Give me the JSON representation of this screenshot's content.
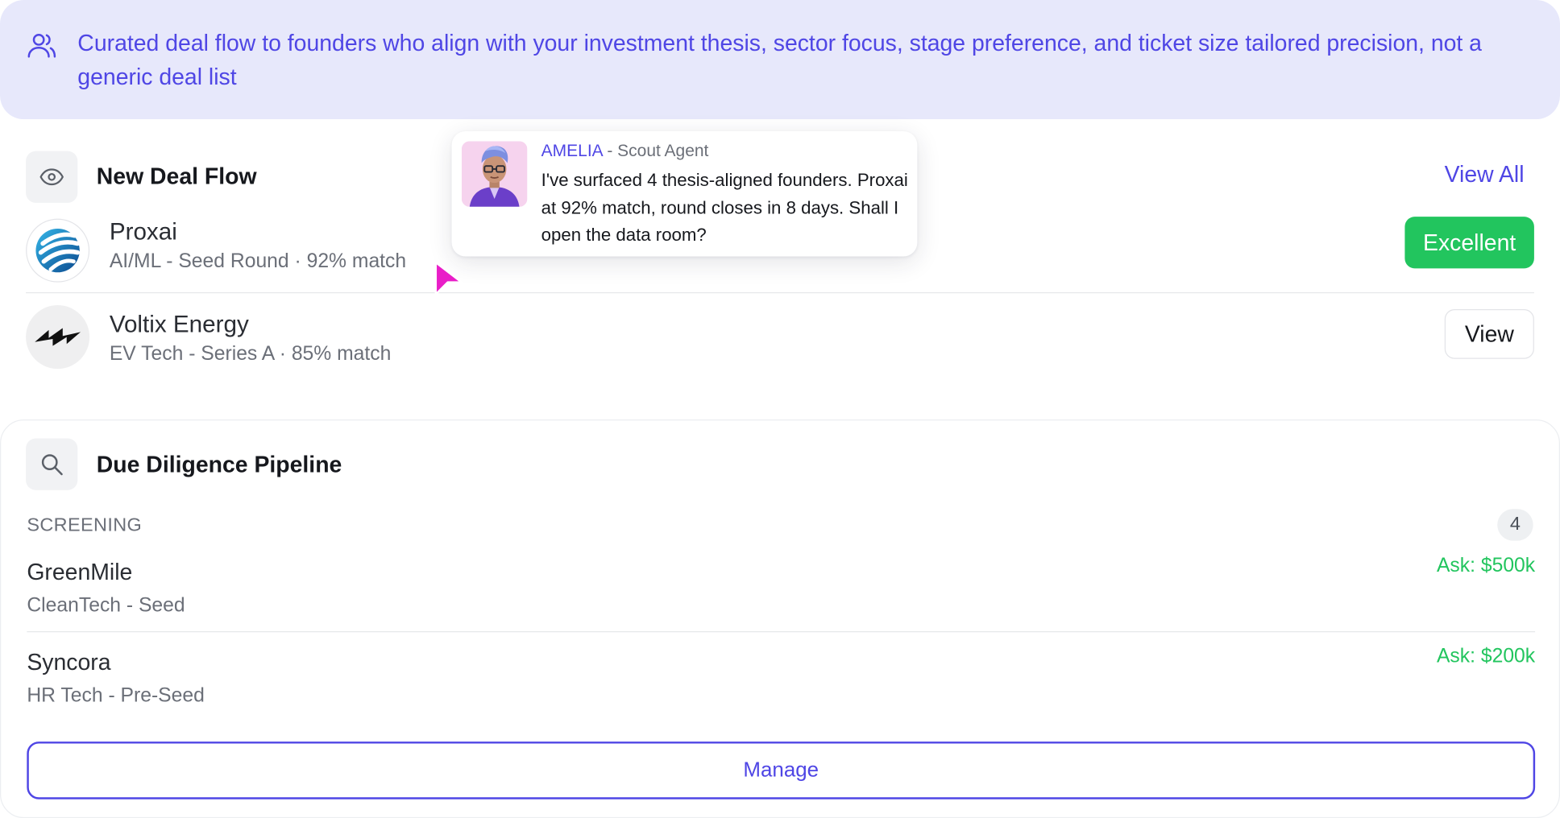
{
  "banner": {
    "text": "Curated deal flow to founders who align with your investment thesis, sector focus, stage preference, and ticket size tailored precision, not a generic deal list"
  },
  "deal_flow": {
    "title": "New Deal Flow",
    "view_all_label": "View All",
    "deals": [
      {
        "name": "Proxai",
        "subtitle": "AI/ML - Seed Round · 92% match",
        "action_label": "Excellent"
      },
      {
        "name": "Voltix Energy",
        "subtitle": "EV Tech - Series A · 85% match",
        "action_label": "View"
      }
    ]
  },
  "agent": {
    "name": "AMELIA",
    "separator": " - ",
    "role": "Scout Agent",
    "message": "I've surfaced 4 thesis-aligned founders. Proxai at 92% match, round closes in 8 days. Shall I open the data room?"
  },
  "pipeline": {
    "title": "Due Diligence Pipeline",
    "stage_label": "SCREENING",
    "count": "4",
    "items": [
      {
        "name": "GreenMile",
        "subtitle": "CleanTech - Seed",
        "ask": "Ask: $500k"
      },
      {
        "name": "Syncora",
        "subtitle": "HR Tech - Pre-Seed",
        "ask": "Ask: $200k"
      }
    ],
    "manage_label": "Manage"
  },
  "colors": {
    "accent": "#4f46e5",
    "success": "#22c55e",
    "banner_bg": "#e7e8fb",
    "cursor": "#e91ec8"
  },
  "icons": {
    "banner": "people-icon",
    "deal_flow": "eye-icon",
    "pipeline": "search-icon",
    "cursor": "cursor-arrow-icon"
  }
}
